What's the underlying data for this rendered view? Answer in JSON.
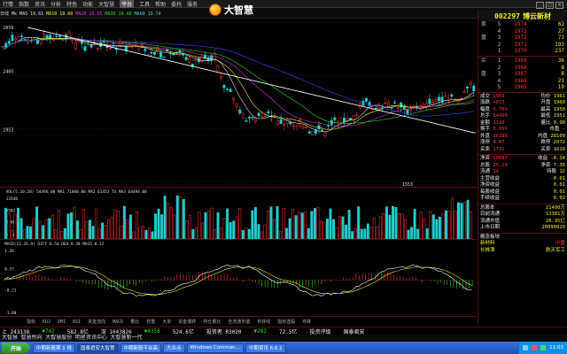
{
  "menu": [
    "行情",
    "指数",
    "资讯",
    "分析",
    "特色",
    "功能",
    "大智慧",
    "平台",
    "工具",
    "帮助",
    "委托",
    "服务"
  ],
  "menu_active": "平台",
  "app_logo": "大智慧",
  "main_indicator": {
    "label": "日线",
    "items": [
      {
        "text": "Mk MA5 19.61",
        "color": "#dddddd"
      },
      {
        "text": "MA10 19.60",
        "color": "#eeee22"
      },
      {
        "text": "MA20 19.55",
        "color": "#dd33dd"
      },
      {
        "text": "MA30 19.48",
        "color": "#22dd22"
      },
      {
        "text": "MA60 19.74",
        "color": "#44cccc"
      }
    ]
  },
  "y_labels_main": [
    "2858",
    "2405",
    "1953"
  ],
  "low_label": "1553",
  "vol_indicator": "VOL(5,10,20)  54496.00  MA1  71060.00  MA2  61453  TO  MA3 64494.00",
  "vol_labels": [
    "13548",
    "8582",
    "3808",
    "X100"
  ],
  "macd_indicator": "MACD(12,26,9)  DIFF 0.54  DEA 0.38  MACD 0.32",
  "macd_labels": [
    "1.36",
    "0.57",
    "-0.21",
    "-1.00"
  ],
  "indicator_tabs": [
    "指标",
    "KDJ",
    "DMI",
    "RSI",
    "资金流向",
    "MACD",
    "量比",
    "权重",
    "大单",
    "资金博弈",
    "持仓量比",
    "全流通市值",
    "布林线",
    "指标选股",
    "布林"
  ],
  "stock": {
    "code": "002297",
    "name": "博云新材"
  },
  "sell_orders": [
    {
      "k": "卖",
      "level": "5",
      "price": "1974",
      "vol": "62"
    },
    {
      "k": "",
      "level": "4",
      "price": "1973",
      "vol": "27"
    },
    {
      "k": "盘",
      "level": "3",
      "price": "1972",
      "vol": "73"
    },
    {
      "k": "",
      "level": "2",
      "price": "1971",
      "vol": "193"
    },
    {
      "k": "",
      "level": "1",
      "price": "1970",
      "vol": "237"
    }
  ],
  "buy_orders": [
    {
      "k": "买",
      "level": "1",
      "price": "1969",
      "vol": "36"
    },
    {
      "k": "",
      "level": "2",
      "price": "1968",
      "vol": "8"
    },
    {
      "k": "盘",
      "level": "3",
      "price": "1967",
      "vol": "8"
    },
    {
      "k": "",
      "level": "4",
      "price": "1966",
      "vol": "21"
    },
    {
      "k": "",
      "level": "5",
      "price": "1965",
      "vol": "19"
    }
  ],
  "quote_rows": [
    {
      "a": "成交",
      "b": "1969",
      "c": "均价",
      "d": "1961"
    },
    {
      "a": "涨跌",
      "b": "+015",
      "c": "开盘",
      "d": "1960"
    },
    {
      "a": "幅度",
      "b": "0.76%",
      "c": "最高",
      "d": "1950"
    },
    {
      "a": "总手",
      "b": "54496",
      "c": "最低",
      "d": "1951"
    },
    {
      "a": "金额",
      "b": "1199",
      "c": "量比",
      "d": "0.90"
    },
    {
      "a": "换手",
      "b": "5.09%",
      "c": "市盈",
      "d": "-"
    },
    {
      "a": "外盘",
      "b": "26388",
      "c": "内盘",
      "d": "28109"
    },
    {
      "a": "涨停",
      "b": "4.07",
      "c": "跌停",
      "d": "2072"
    },
    {
      "a": "买卖",
      "b": "1731",
      "c": "买卖",
      "d": "1619"
    }
  ],
  "fin_rows": [
    {
      "a": "净资",
      "b": "10687",
      "c": "收益",
      "d": "-0.34"
    },
    {
      "a": "总股",
      "b": "25.29",
      "c": "净资",
      "d": "7.35"
    },
    {
      "a": "流通",
      "b": "14",
      "c": "持股",
      "d": "12"
    },
    {
      "a": "主营收益",
      "b": "",
      "c": "",
      "d": "-0.01"
    },
    {
      "a": "净资收益",
      "b": "",
      "c": "",
      "d": "0.01"
    },
    {
      "a": "每股收益",
      "b": "",
      "c": "",
      "d": "0.01"
    },
    {
      "a": "手续收益",
      "b": "",
      "c": "",
      "d": "0.02"
    }
  ],
  "company_rows": [
    {
      "a": "总股本",
      "b": "21400万"
    },
    {
      "a": "目前流通",
      "b": "13381万"
    },
    {
      "a": "流通市值",
      "b": "26.35亿"
    },
    {
      "a": "上市日期",
      "b": "20090929"
    }
  ],
  "sector": {
    "label": "概念板块",
    "a": "新材料",
    "b": "中盘",
    "c": "长株潭",
    "d": "航天军工"
  },
  "status": [
    {
      "text": "上 243138",
      "color": "#eeeeee"
    },
    {
      "text": "▼742",
      "color": "#22dd22"
    },
    {
      "text": "582.8亿",
      "color": "#eeeeee"
    },
    {
      "text": "深 1043826",
      "color": "#eeeeee"
    },
    {
      "text": "▼4358",
      "color": "#22dd22"
    },
    {
      "text": "524.6亿",
      "color": "#eeeeee"
    },
    {
      "text": "投资者 R3020",
      "color": "#eeeeee"
    },
    {
      "text": "▼282",
      "color": "#22dd22"
    },
    {
      "text": "72.5亿",
      "color": "#eeeeee"
    },
    {
      "text": "投资评级",
      "color": "#eeeeee"
    },
    {
      "text": "国泰君安",
      "color": "#eeeeee"
    }
  ],
  "ticker": "大智慧 智慧所向 大智慧股份 明星资讯中心 大智慧新一代",
  "taskbar": {
    "start": "开始",
    "tasks": [
      "中期新股票 1 线",
      "国泰君安大智慧",
      "中期新股平台高",
      "大众点",
      "Windows Comman...",
      "中期资讯 6.6.1"
    ],
    "active_index": 1,
    "clock": "11:03"
  }
}
